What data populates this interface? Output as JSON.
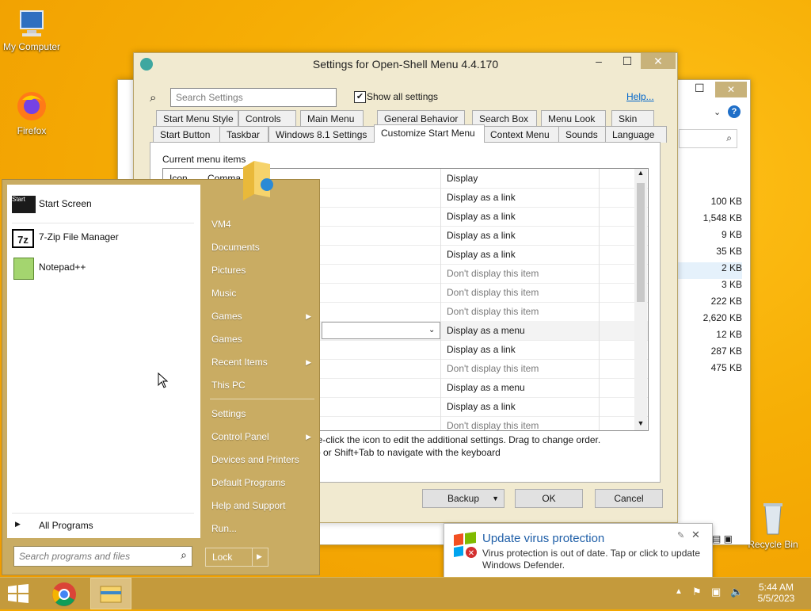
{
  "desktop": {
    "icons": [
      {
        "label": "My Computer"
      },
      {
        "label": "Firefox"
      },
      {
        "label": "Recycle Bin"
      }
    ]
  },
  "settings_window": {
    "title": "Settings for Open-Shell Menu 4.4.170",
    "search_placeholder": "Search Settings",
    "show_all_label": "Show all settings",
    "help_link": "Help...",
    "tabs_row1": [
      "Start Menu Style",
      "Controls",
      "Main Menu",
      "General Behavior",
      "Search Box",
      "Menu Look",
      "Skin"
    ],
    "tabs_row2": [
      "Start Button",
      "Taskbar",
      "Windows 8.1 Settings",
      "Customize Start Menu",
      "Context Menu",
      "Sounds",
      "Language"
    ],
    "active_tab": "Customize Start Menu",
    "current_items_label": "Current menu items",
    "col_icon": "Icon",
    "col_command": "Comma",
    "rows": [
      {
        "display": "Display",
        "dim": false
      },
      {
        "display": "Display as a link",
        "dim": false
      },
      {
        "display": "Display as a link",
        "dim": false
      },
      {
        "display": "Display as a link",
        "dim": false
      },
      {
        "display": "Display as a link",
        "dim": false
      },
      {
        "display": "Don't display this item",
        "dim": true
      },
      {
        "display": "Don't display this item",
        "dim": true
      },
      {
        "display": "Don't display this item",
        "dim": true
      },
      {
        "display": "Display as a menu",
        "dim": false
      },
      {
        "display": "Display as a link",
        "dim": false
      },
      {
        "display": "Don't display this item",
        "dim": true
      },
      {
        "display": "Display as a menu",
        "dim": false
      },
      {
        "display": "Display as a link",
        "dim": false
      },
      {
        "display": "Don't display this item",
        "dim": true
      }
    ],
    "hint1": "le-click the icon to edit the additional settings. Drag to change order.",
    "hint2": "b or Shift+Tab to navigate with the keyboard",
    "backup_label": "Backup",
    "ok_label": "OK",
    "cancel_label": "Cancel"
  },
  "explorer_bg": {
    "sizes": [
      "100 KB",
      "1,548 KB",
      "9 KB",
      "35 KB",
      "2 KB",
      "3 KB",
      "222 KB",
      "2,620 KB",
      "12 KB",
      "287 KB",
      "475 KB"
    ]
  },
  "start_menu": {
    "left_items": [
      {
        "label": "Start Screen",
        "icon": "start-screen-icon"
      },
      {
        "label": "7-Zip File Manager",
        "icon": "7zip-icon"
      },
      {
        "label": "Notepad++",
        "icon": "notepadpp-icon"
      }
    ],
    "start_icon_text": "Start",
    "zip_icon_text": "7z",
    "all_programs": "All Programs",
    "search_placeholder": "Search programs and files",
    "right_items": [
      {
        "label": "VM4",
        "arrow": false
      },
      {
        "label": "Documents",
        "arrow": false
      },
      {
        "label": "Pictures",
        "arrow": false
      },
      {
        "label": "Music",
        "arrow": false
      },
      {
        "label": "Games",
        "arrow": true
      },
      {
        "label": "Games",
        "arrow": false
      },
      {
        "label": "Recent Items",
        "arrow": true
      },
      {
        "label": "This PC",
        "arrow": false
      },
      {
        "label": "Settings",
        "arrow": false
      },
      {
        "label": "Control Panel",
        "arrow": true
      },
      {
        "label": "Devices and Printers",
        "arrow": false
      },
      {
        "label": "Default Programs",
        "arrow": false
      },
      {
        "label": "Help and Support",
        "arrow": false
      },
      {
        "label": "Run...",
        "arrow": false
      }
    ],
    "lock_label": "Lock"
  },
  "toast": {
    "title": "Update virus protection",
    "body": "Virus protection is out of date. Tap or click to update Windows Defender."
  },
  "clock": {
    "time": "5:44 AM",
    "date": "5/5/2023"
  },
  "colors": {
    "accent": "#c49a3c",
    "link": "#0066cc",
    "toast_title": "#1f5fa8"
  }
}
